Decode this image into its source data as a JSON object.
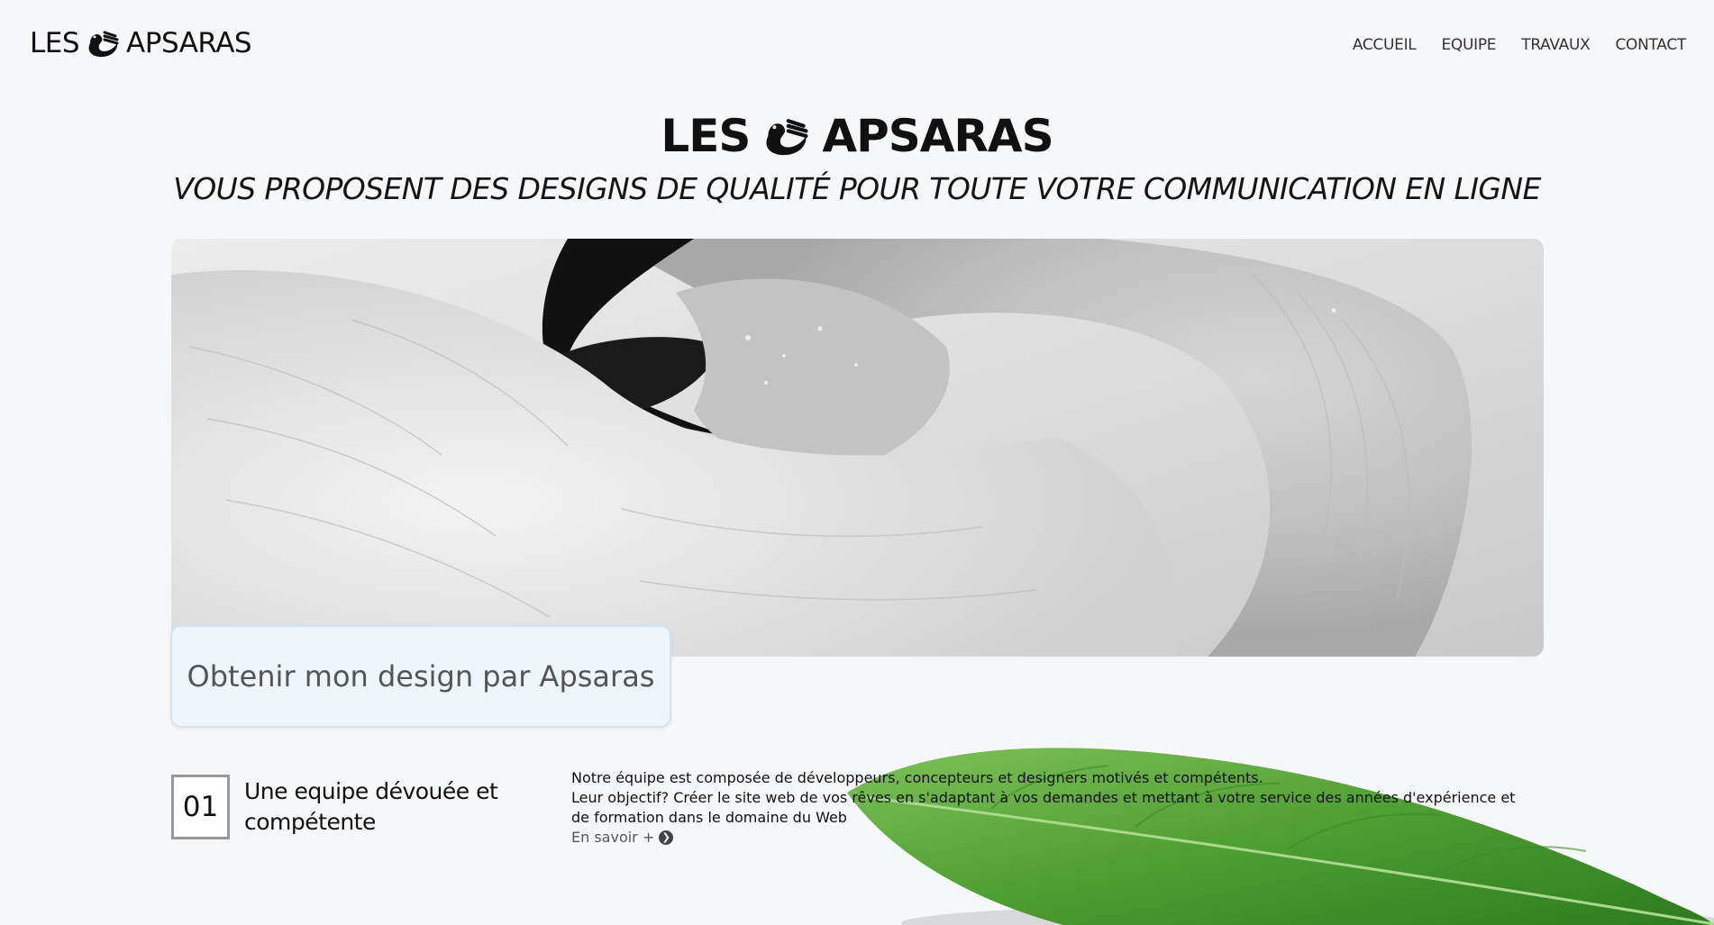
{
  "header": {
    "brand_left": "LES",
    "brand_right": "APSARAS",
    "nav": [
      "ACCUEIL",
      "EQUIPE",
      "TRAVAUX",
      "CONTACT"
    ]
  },
  "hero": {
    "title_left": "LES",
    "title_right": "APSARAS",
    "subtitle": "VOUS PROPOSENT DES DESIGNS DE QUALITÉ POUR TOUTE VOTRE COMMUNICATION EN LIGNE",
    "image_icon": "swan-photo",
    "cta_label": "Obtenir mon design par Apsaras"
  },
  "feature": {
    "number": "01",
    "title": "Une equipe dévouée et compétente",
    "line1": "Notre équipe est composée de développeurs, concepteurs et designers motivés et compétents.",
    "line2": "Leur objectif? Créer le site web de vos rêves en s'adaptant à vos demandes et mettant à votre service des années d'expérience et de formation dans le domaine du Web",
    "more_label": "En savoir +",
    "more_icon": "chevron-right-circle-icon"
  },
  "decor": {
    "leaf_icon": "leaf-image",
    "logo_icon": "swan-logo-icon"
  }
}
